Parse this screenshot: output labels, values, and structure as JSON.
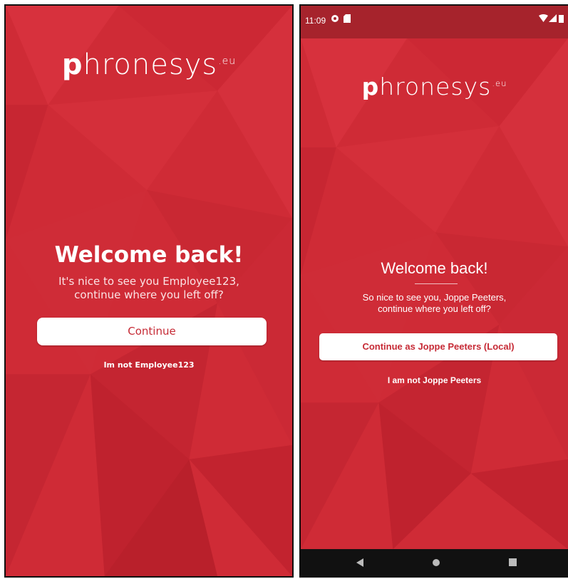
{
  "colors": {
    "accent": "#cf2b36",
    "dark_red": "#a6232c",
    "button_text": "#c62a35",
    "button_bg": "#ffffff"
  },
  "left_screen": {
    "logo": {
      "mark": "p",
      "text": "hronesys",
      "suffix": ".eu"
    },
    "title": "Welcome back!",
    "subtitle_line1": "It's nice to see you Employee123,",
    "subtitle_line2": "continue where you left off?",
    "continue_label": "Continue",
    "not_user_label": "Im not Employee123"
  },
  "right_screen": {
    "status_bar": {
      "time": "11:09",
      "icons": [
        "notification-icon",
        "sd-card-icon",
        "wifi-icon",
        "signal-icon",
        "battery-icon"
      ]
    },
    "logo": {
      "mark": "p",
      "text": "hronesys",
      "suffix": ".eu"
    },
    "title": "Welcome back!",
    "subtitle_line1": "So nice to see you, Joppe Peeters,",
    "subtitle_line2": "continue where you left off?",
    "continue_label": "Continue as Joppe Peeters (Local)",
    "not_user_label": "I am not Joppe Peeters",
    "nav_bar": {
      "icons": [
        "back-icon",
        "home-icon",
        "recents-icon"
      ]
    }
  }
}
